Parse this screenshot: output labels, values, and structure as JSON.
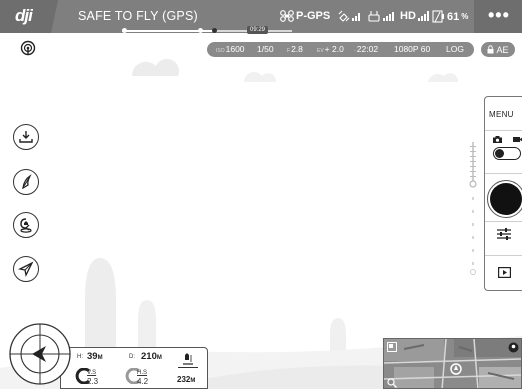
{
  "topbar": {
    "logo": "dji",
    "status": "SAFE TO FLY  (GPS)",
    "flight_mode": "P-GPS",
    "hd_label": "HD",
    "battery_percent": "61",
    "battery_unit": "%",
    "more_label": "•••",
    "timeline_time": "09:29",
    "timeline_progress": 0.55
  },
  "camera_params": {
    "iso_label": "ISO",
    "iso_value": "1600",
    "shutter": "1/50",
    "f_label": "F",
    "aperture": "2.8",
    "ev_label": "EV",
    "ev_value": "+ 2.0",
    "remaining_time": "22:02",
    "resolution": "1080P 60",
    "color_profile": "LOG",
    "ae_label": "AE"
  },
  "camera_panel": {
    "menu_label": "MENU",
    "mode": "photo"
  },
  "telemetry": {
    "h_label": "H:",
    "h_value": "39",
    "h_unit": "M",
    "d_label": "D:",
    "d_value": "210",
    "d_unit": "M",
    "vs_label": "V.S",
    "vs_value": "2.3",
    "hs_label": "H.S",
    "hs_value": "4.2",
    "alt_value": "232",
    "alt_unit": "M"
  },
  "icons": {
    "gps": "gps-signal-icon",
    "takeoff": "auto-takeoff-icon",
    "intelligent": "intelligent-flight-icon",
    "rth": "return-home-icon",
    "waypoint": "navigation-icon"
  },
  "colors": {
    "topbar": "#7f7f7f",
    "accent": "#222222"
  }
}
